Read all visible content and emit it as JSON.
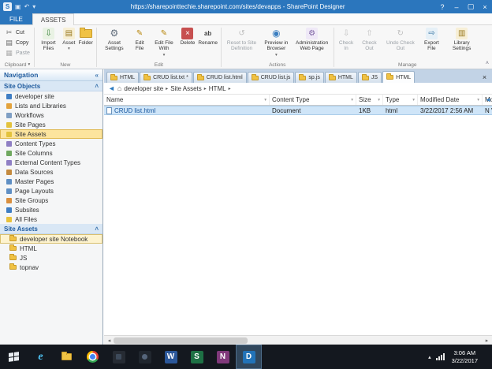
{
  "colors": {
    "titlebar": "#2b76bd",
    "accent": "#2b76bd",
    "ribbon_bg": "#f7f7f7",
    "sidebar_selected": "#fce49e",
    "row_selected": "#cfe5f8",
    "tab_strip": "#c2d3e6",
    "taskbar": "#14181f",
    "folder": "#f0c243"
  },
  "glyphs": {
    "app": "S",
    "save": "▣",
    "undo": "↶",
    "qat_menu": "▾",
    "help": "?",
    "minimize": "–",
    "maximize": "▢",
    "close": "×",
    "collapse_pane": "«",
    "collapse_section": "˄",
    "collapse_ribbon": "˄",
    "dropdown": "▾",
    "filter": "▾",
    "back": "◄",
    "home": "⌂",
    "crumb": "▸",
    "tab_close": "×",
    "scroll_left": "◄",
    "hs_left": "◂",
    "hs_right": "▸",
    "tray_up": "▴",
    "cut": "✂",
    "copy": "▤",
    "paste": "▦",
    "import": "⇩",
    "asset": "▤",
    "gear": "⚙",
    "pencil": "✎",
    "delete": "×",
    "rename": "ab",
    "reset": "↺",
    "preview": "◉",
    "check_in": "⇩",
    "check_out": "⇧",
    "undo_check": "↻",
    "export": "⇨",
    "library": "▥",
    "ie": "e",
    "word": "W",
    "sp": "S",
    "onenote": "N",
    "spd": "D"
  },
  "titlebar": {
    "url": "https://sharepointtechie.sharepoint.com/sites/devapps - SharePoint Designer"
  },
  "ribbon": {
    "tabs": [
      {
        "label": "FILE"
      },
      {
        "label": "ASSETS"
      }
    ],
    "groups": {
      "clipboard": {
        "label": "Clipboard",
        "cut": "Cut",
        "copy": "Copy",
        "paste": "Paste"
      },
      "new_group": {
        "label": "New",
        "import_files": "Import Files",
        "asset": "Asset",
        "folder": "Folder"
      },
      "edit": {
        "label": "Edit",
        "asset_settings": "Asset Settings",
        "edit_file": "Edit File",
        "edit_file_with": "Edit File With",
        "delete_btn": "Delete",
        "rename": "Rename"
      },
      "actions": {
        "label": "Actions",
        "reset": "Reset to Site Definition",
        "preview": "Preview in Browser",
        "admin": "Administration Web Page"
      },
      "manage": {
        "label": "Manage",
        "check_in": "Check In",
        "check_out": "Check Out",
        "undo_check_out": "Undo Check Out",
        "export_file": "Export File",
        "library_settings": "Library Settings"
      }
    }
  },
  "navigation": {
    "title": "Navigation",
    "site_objects": {
      "title": "Site Objects",
      "items": [
        {
          "label": "developer site",
          "icon_color": "#3f7ec4"
        },
        {
          "label": "Lists and Libraries",
          "icon_color": "#e3a23c"
        },
        {
          "label": "Workflows",
          "icon_color": "#7f9fc4"
        },
        {
          "label": "Site Pages",
          "icon_color": "#e3c23c"
        },
        {
          "label": "Site Assets",
          "icon_color": "#e3c23c",
          "selected": true
        },
        {
          "label": "Content Types",
          "icon_color": "#8f7fc4"
        },
        {
          "label": "Site Columns",
          "icon_color": "#6fa85f"
        },
        {
          "label": "External Content Types",
          "icon_color": "#8f7fc4"
        },
        {
          "label": "Data Sources",
          "icon_color": "#c48a3f"
        },
        {
          "label": "Master Pages",
          "icon_color": "#5f8fc4"
        },
        {
          "label": "Page Layouts",
          "icon_color": "#5f8fc4"
        },
        {
          "label": "Site Groups",
          "icon_color": "#d98f3f"
        },
        {
          "label": "Subsites",
          "icon_color": "#3f7ec4"
        },
        {
          "label": "All Files",
          "icon_color": "#e8c23c"
        }
      ]
    },
    "site_assets_pane": {
      "title": "Site Assets",
      "items": [
        {
          "label": "developer site Notebook",
          "selected": true
        },
        {
          "label": "HTML"
        },
        {
          "label": "JS"
        },
        {
          "label": "topnav"
        }
      ]
    }
  },
  "editor": {
    "tabs": [
      {
        "label": "HTML"
      },
      {
        "label": "CRUD list.txt *"
      },
      {
        "label": "CRUD list.html"
      },
      {
        "label": "CRUD list.js"
      },
      {
        "label": "sp.js"
      },
      {
        "label": "HTML"
      },
      {
        "label": "JS"
      },
      {
        "label": "HTML",
        "active": true
      }
    ],
    "breadcrumb": [
      "developer site",
      "Site Assets",
      "HTML"
    ],
    "columns": [
      {
        "label": "Name"
      },
      {
        "label": "Content Type"
      },
      {
        "label": "Size"
      },
      {
        "label": "Type"
      },
      {
        "label": "Modified Date"
      },
      {
        "label": "Mo"
      }
    ],
    "rows": [
      {
        "cells": [
          "CRUD list.html",
          "Document",
          "1KB",
          "html",
          "3/22/2017 2:56 AM",
          "N Vi"
        ]
      }
    ]
  },
  "taskbar": {
    "tray": {
      "time": "3:06 AM",
      "date": "3/22/2017"
    }
  }
}
